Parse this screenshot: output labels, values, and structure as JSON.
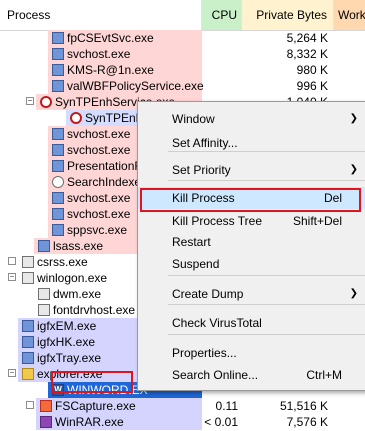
{
  "columns": {
    "process": "Process",
    "cpu": "CPU",
    "private_bytes": "Private Bytes",
    "working": "Work"
  },
  "rows": [
    {
      "name": "fpCSEvtSvc.exe",
      "cpu": "",
      "priv": "5,264 K",
      "work": "",
      "icon": "blue",
      "bg": "#ffd6d6"
    },
    {
      "name": "svchost.exe",
      "cpu": "",
      "priv": "8,332 K",
      "work": "1",
      "icon": "blue",
      "bg": "#ffd6d6"
    },
    {
      "name": "KMS-R@1n.exe",
      "cpu": "",
      "priv": "980 K",
      "work": "",
      "icon": "blue",
      "bg": "#ffd6d6"
    },
    {
      "name": "valWBFPolicyService.exe",
      "cpu": "",
      "priv": "996 K",
      "work": "",
      "icon": "blue",
      "bg": "#ffd6d6"
    },
    {
      "name": "SynTPEnhService.exe",
      "cpu": "",
      "priv": "1,040 K",
      "work": "",
      "icon": "syn",
      "bg": "#ffd6d6"
    },
    {
      "name": "SynTPEnh",
      "cpu": "",
      "priv": "",
      "work": "",
      "icon": "syn",
      "bg": "#d4dcff"
    },
    {
      "name": "svchost.exe",
      "cpu": "",
      "priv": "",
      "work": "",
      "icon": "blue",
      "bg": "#ffd6d6"
    },
    {
      "name": "svchost.exe",
      "cpu": "",
      "priv": "",
      "work": "",
      "icon": "blue",
      "bg": "#ffd6d6"
    },
    {
      "name": "PresentationFo",
      "cpu": "",
      "priv": "",
      "work": "",
      "icon": "blue",
      "bg": "#ffd6d6"
    },
    {
      "name": "SearchIndexe",
      "cpu": "",
      "priv": "",
      "work": "",
      "icon": "search",
      "bg": "#ffd6d6"
    },
    {
      "name": "svchost.exe",
      "cpu": "",
      "priv": "",
      "work": "",
      "icon": "blue",
      "bg": "#ffd6d6"
    },
    {
      "name": "svchost.exe",
      "cpu": "",
      "priv": "",
      "work": "",
      "icon": "blue",
      "bg": "#ffd6d6"
    },
    {
      "name": "sppsvc.exe",
      "cpu": "",
      "priv": "",
      "work": "",
      "icon": "blue",
      "bg": "#ffd6d6"
    },
    {
      "name": "lsass.exe",
      "cpu": "",
      "priv": "",
      "work": "",
      "icon": "blue",
      "bg": "#ffd6d6"
    },
    {
      "name": "csrss.exe",
      "cpu": "",
      "priv": "",
      "work": "",
      "icon": "gray",
      "bg": ""
    },
    {
      "name": "winlogon.exe",
      "cpu": "",
      "priv": "",
      "work": "",
      "icon": "gray",
      "bg": ""
    },
    {
      "name": "dwm.exe",
      "cpu": "",
      "priv": "",
      "work": "",
      "icon": "gray",
      "bg": ""
    },
    {
      "name": "fontdrvhost.exe",
      "cpu": "",
      "priv": "",
      "work": "",
      "icon": "gray",
      "bg": ""
    },
    {
      "name": "igfxEM.exe",
      "cpu": "",
      "priv": "",
      "work": "",
      "icon": "blue",
      "bg": "#d4d4ff"
    },
    {
      "name": "igfxHK.exe",
      "cpu": "",
      "priv": "",
      "work": "",
      "icon": "blue",
      "bg": "#d4d4ff"
    },
    {
      "name": "igfxTray.exe",
      "cpu": "",
      "priv": "",
      "work": "",
      "icon": "blue",
      "bg": "#d4d4ff"
    },
    {
      "name": "explorer.exe",
      "cpu": "",
      "priv": "",
      "work": "",
      "icon": "folder",
      "bg": "#d4d4ff"
    },
    {
      "name": "WINWORD.EX",
      "cpu": "",
      "priv": "",
      "work": "",
      "icon": "word",
      "bg": "#1f66d6"
    },
    {
      "name": "FSCapture.exe",
      "cpu": "0.11",
      "priv": "51,516 K",
      "work": "6",
      "icon": "fsc",
      "bg": "#d4d4ff"
    },
    {
      "name": "WinRAR.exe",
      "cpu": "< 0.01",
      "priv": "7,576 K",
      "work": "2",
      "icon": "rar",
      "bg": "#d4d4ff"
    }
  ],
  "context_menu": [
    {
      "label": "Window",
      "shortcut": "",
      "submenu": true
    },
    {
      "label": "Set Affinity...",
      "shortcut": "",
      "submenu": false
    },
    {
      "label": "Set Priority",
      "shortcut": "",
      "submenu": true
    },
    {
      "label": "Kill Process",
      "shortcut": "Del",
      "submenu": false
    },
    {
      "label": "Kill Process Tree",
      "shortcut": "Shift+Del",
      "submenu": false
    },
    {
      "label": "Restart",
      "shortcut": "",
      "submenu": false
    },
    {
      "label": "Suspend",
      "shortcut": "",
      "submenu": false
    },
    {
      "label": "Create Dump",
      "shortcut": "",
      "submenu": true
    },
    {
      "label": "Check VirusTotal",
      "shortcut": "",
      "submenu": false
    },
    {
      "label": "Properties...",
      "shortcut": "",
      "submenu": false
    },
    {
      "label": "Search Online...",
      "shortcut": "Ctrl+M",
      "submenu": false
    }
  ],
  "colors": {
    "highlight": "#cde8ff",
    "selection": "#1f66d6",
    "callout": "#e0141c"
  }
}
